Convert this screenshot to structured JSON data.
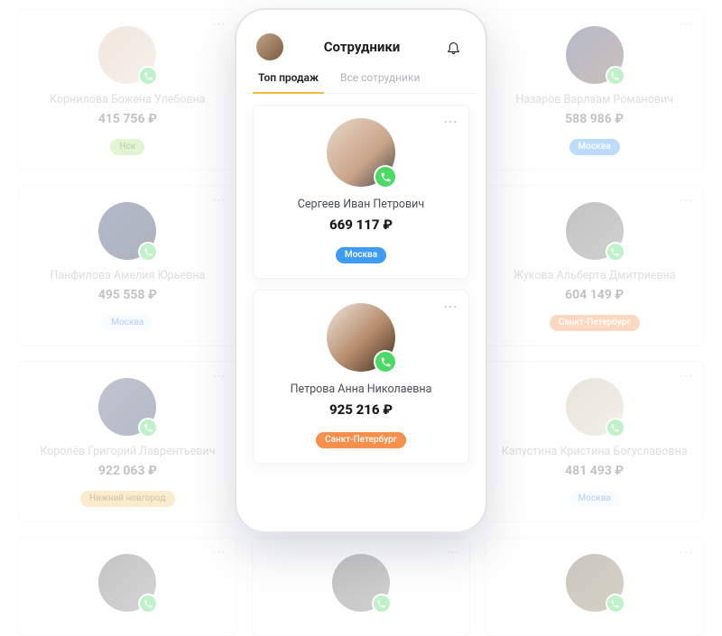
{
  "header": {
    "title": "Сотрудники"
  },
  "tabs": [
    {
      "label": "Топ продаж",
      "active": true
    },
    {
      "label": "Все сотрудники",
      "active": false
    }
  ],
  "employees_foreground": [
    {
      "name": "Сергеев Иван Петрович",
      "amount": "669 117 ₽",
      "city": "Москва",
      "city_style": "blue",
      "avatar_class": "fg1"
    },
    {
      "name": "Петрова Анна Николаевна",
      "amount": "925 216 ₽",
      "city": "Санкт-Петербург",
      "city_style": "orange",
      "avatar_class": "fg2"
    }
  ],
  "employees_background": [
    {
      "name": "Корнилова Божена Улебовна",
      "amount": "415 756 ₽",
      "city": "Нск",
      "city_style": "green",
      "avatar_class": "g1"
    },
    {
      "name": "",
      "amount": "",
      "city": "",
      "city_style": "",
      "avatar_class": "g4"
    },
    {
      "name": "Назаров Варлаам Романович",
      "amount": "588 986 ₽",
      "city": "Москва",
      "city_style": "blue",
      "avatar_class": "g2"
    },
    {
      "name": "Панфилова Амелия Юрьевна",
      "amount": "495 558 ₽",
      "city": "Москва",
      "city_style": "pale",
      "avatar_class": "g3"
    },
    {
      "name": "",
      "amount": "",
      "city": "",
      "city_style": "",
      "avatar_class": "g4"
    },
    {
      "name": "Жукова Альберта Дмитриевна",
      "amount": "604 149 ₽",
      "city": "Санкт-Петербург",
      "city_style": "orange",
      "avatar_class": "g4"
    },
    {
      "name": "Королёв Григорий Лаврентьевич",
      "amount": "922 063 ₽",
      "city": "Нижний новгород",
      "city_style": "yellow",
      "avatar_class": "g5"
    },
    {
      "name": "",
      "amount": "",
      "city": "",
      "city_style": "",
      "avatar_class": "g4"
    },
    {
      "name": "Капустина Кристина Богуславовна",
      "amount": "481 493 ₽",
      "city": "Москва",
      "city_style": "pale",
      "avatar_class": "g6"
    },
    {
      "name": "",
      "amount": "",
      "city": "",
      "city_style": "",
      "avatar_class": "g7"
    },
    {
      "name": "",
      "amount": "",
      "city": "",
      "city_style": "",
      "avatar_class": "g4"
    },
    {
      "name": "",
      "amount": "",
      "city": "",
      "city_style": "",
      "avatar_class": "g8"
    }
  ]
}
